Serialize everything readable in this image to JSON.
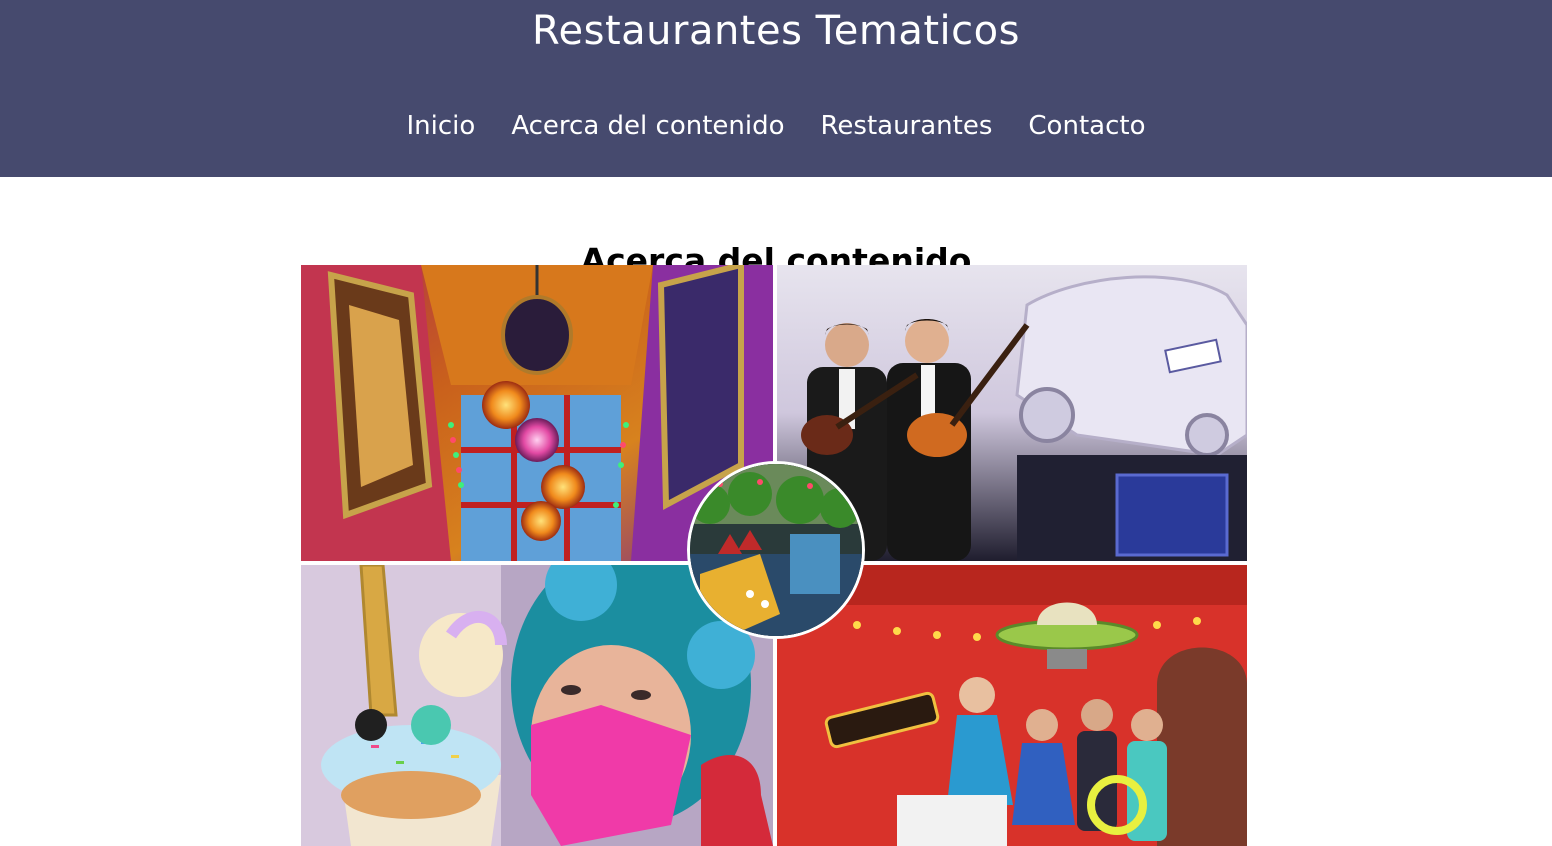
{
  "header": {
    "title": "Restaurantes Tematicos",
    "background_color": "#464a6e",
    "nav": [
      {
        "label": "Inicio"
      },
      {
        "label": "Acerca del contenido"
      },
      {
        "label": "Restaurantes"
      },
      {
        "label": "Contacto"
      }
    ]
  },
  "main": {
    "section_title": "Acerca del contenido",
    "collage": {
      "tiles": [
        {
          "icon": "lanterns-interior-photo"
        },
        {
          "icon": "beatles-performers-photo"
        },
        {
          "icon": "unicorn-dessert-photo"
        },
        {
          "icon": "retro-diner-performers-photo"
        },
        {
          "icon": "garden-restaurant-photo"
        }
      ]
    }
  }
}
